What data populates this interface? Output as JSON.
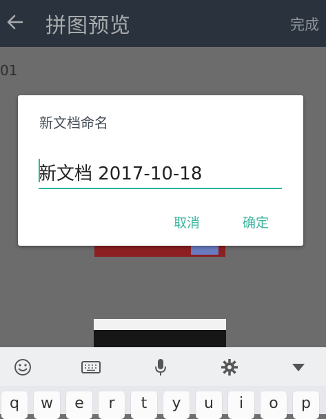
{
  "appbar": {
    "title": "拼图预览",
    "done_label": "完成"
  },
  "content": {
    "page_number": "01"
  },
  "dialog": {
    "title": "新文档命名",
    "input_value": "新文档 2017-10-18",
    "cancel_label": "取消",
    "ok_label": "确定"
  },
  "keyboard": {
    "toolbar_icons": [
      "emoji-icon",
      "keyboard-icon",
      "microphone-icon",
      "settings-icon",
      "hide-keyboard-icon"
    ],
    "keys": [
      "q",
      "w",
      "e",
      "r",
      "t",
      "y",
      "u",
      "i",
      "o",
      "p"
    ]
  },
  "colors": {
    "accent": "#2bb5a0",
    "appbar": "#2a333d"
  }
}
